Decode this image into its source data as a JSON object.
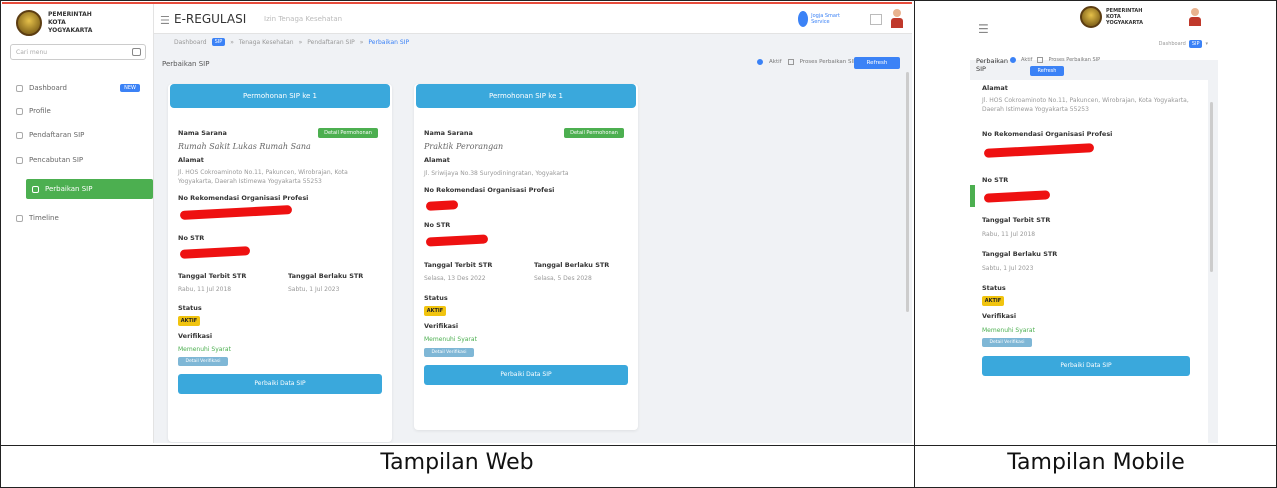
{
  "captions": {
    "web": "Tampilan Web",
    "mobile": "Tampilan Mobile"
  },
  "app": {
    "logo_text": "PEMERINTAH KOTA YOGYAKARTA",
    "title": "E-REGULASI",
    "subtitle": "Izin Tenaga Kesehatan",
    "brand": "Jogja Smart Service"
  },
  "sidebar": {
    "search_placeholder": "Cari menu",
    "items": [
      {
        "label": "Dashboard",
        "badge": "NEW"
      },
      {
        "label": "Profile"
      },
      {
        "label": "Pendaftaran SIP"
      },
      {
        "label": "Pencabutan SIP"
      },
      {
        "label": "Perbaikan SIP"
      },
      {
        "label": "Timeline"
      }
    ]
  },
  "breadcrumbs": {
    "badge": "SIP",
    "items": [
      "Dashboard",
      "Tenaga Kesehatan",
      "Pendaftaran SIP",
      "Perbaikan SIP"
    ]
  },
  "page": {
    "title": "Perbaikan SIP",
    "radio_aktif": "Aktif",
    "radio_proses": "Proses Perbaikan SIP",
    "refresh": "Refresh"
  },
  "cards": [
    {
      "header": "Permohonan SIP ke 1",
      "nama_label": "Nama Sarana",
      "detail_btn": "Detail Permohonan",
      "nama_value": "Rumah Sakit Lukas Rumah Sana",
      "alamat_label": "Alamat",
      "alamat_value": "Jl. HOS Cokroaminoto No.11, Pakuncen, Wirobrajan, Kota Yogyakarta, Daerah Istimewa Yogyakarta 55253",
      "rekom_label": "No Rekomendasi Organisasi Profesi",
      "str_label": "No STR",
      "terbit_label": "Tanggal Terbit STR",
      "terbit_value": "Rabu, 11 Jul 2018",
      "berlaku_label": "Tanggal Berlaku STR",
      "berlaku_value": "Sabtu, 1 Jul 2023",
      "status_label": "Status",
      "status_value": "AKTIF",
      "verif_label": "Verifikasi",
      "verif_value": "Memenuhi Syarat",
      "verif_btn": "Detail Verifikasi",
      "renew_btn": "Perbaiki Data SIP"
    },
    {
      "header": "Permohonan SIP ke 1",
      "nama_label": "Nama Sarana",
      "detail_btn": "Detail Permohonan",
      "nama_value": "Praktik Perorangan",
      "alamat_label": "Alamat",
      "alamat_value": "Jl. Sriwijaya No.38 Suryodiningratan, Yogyakarta",
      "rekom_label": "No Rekomendasi Organisasi Profesi",
      "str_label": "No STR",
      "terbit_label": "Tanggal Terbit STR",
      "terbit_value": "Selasa, 13 Des 2022",
      "berlaku_label": "Tanggal Berlaku STR",
      "berlaku_value": "Selasa, 5 Des 2028",
      "status_label": "Status",
      "status_value": "AKTIF",
      "verif_label": "Verifikasi",
      "verif_value": "Memenuhi Syarat",
      "verif_btn": "Detail Verifikasi",
      "renew_btn": "Perbaiki Data SIP"
    }
  ],
  "mobile": {
    "badge": "SIP",
    "badge_label": "Dashboard",
    "title": "Perbaikan SIP",
    "radio_aktif": "Aktif",
    "radio_proses": "Proses Perbaikan SIP",
    "refresh": "Refresh",
    "alamat_label": "Alamat",
    "alamat_value": "Jl. HOS Cokroaminoto No.11, Pakuncen, Wirobrajan, Kota Yogyakarta, Daerah Istimewa Yogyakarta 55253",
    "rekom_label": "No Rekomendasi Organisasi Profesi",
    "str_label": "No STR",
    "terbit_label": "Tanggal Terbit STR",
    "terbit_value": "Rabu, 11 Jul 2018",
    "berlaku_label": "Tanggal Berlaku STR",
    "berlaku_value": "Sabtu, 1 Jul 2023",
    "status_label": "Status",
    "status_value": "AKTIF",
    "verif_label": "Verifikasi",
    "verif_value": "Memenuhi Syarat",
    "verif_btn": "Detail Verifikasi",
    "renew_btn": "Perbaiki Data SIP"
  }
}
